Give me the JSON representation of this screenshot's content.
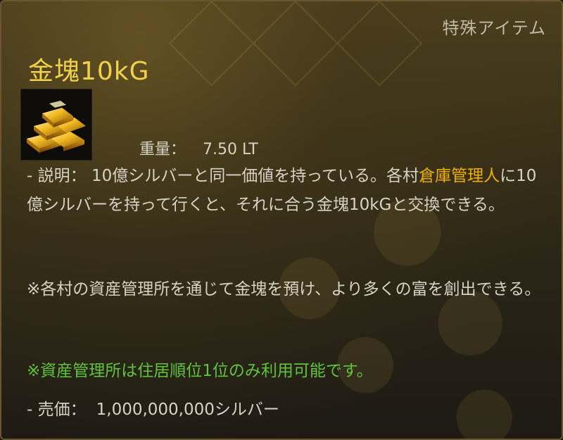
{
  "tooltip": {
    "category": "特殊アイテム",
    "title": "金塊10kG",
    "icon": "gold-bars-icon",
    "weight_label": "重量：",
    "weight_value": "7.50 LT",
    "description": {
      "prefix": "- 説明：",
      "text_1": "10億シルバーと同一価値を持っている。各村",
      "highlight": "倉庫管理人",
      "text_2": "に10億シルバーを持って行くと、それに合う金塊10kGと交換できる。"
    },
    "note": "※各村の資産管理所を通じて金塊を預け、より多くの富を創出できる。",
    "green_note": "※資産管理所は住居順位1位のみ利用可能です。",
    "price_label": "- 売価：",
    "price_value": "1,000,000,000シルバー"
  },
  "colors": {
    "title": "#f0d24a",
    "highlight": "#f0b000",
    "green": "#5fc43a",
    "text": "#d6d2c4",
    "category": "#bfb9a6"
  }
}
